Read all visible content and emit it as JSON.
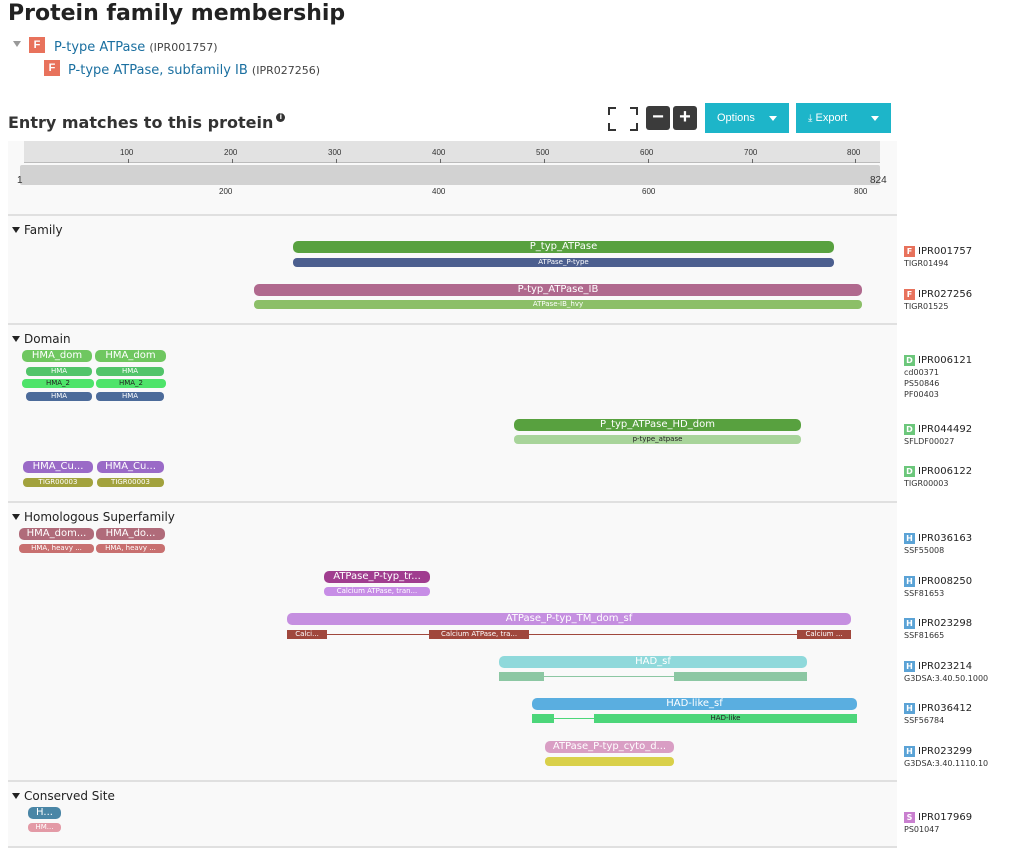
{
  "title": "Protein family membership",
  "family_tree": [
    {
      "badge": "F",
      "name": "P-type ATPase",
      "acc": "(IPR001757)"
    },
    {
      "badge": "F",
      "name": "P-type ATPase, subfamily IB",
      "acc": "(IPR027256)"
    }
  ],
  "entry_title": "Entry matches to this protein",
  "toolbar": {
    "options_label": "Options",
    "export_label": "Export",
    "minus": "−",
    "plus": "+"
  },
  "ruler": {
    "top_ticks": [
      "100",
      "200",
      "300",
      "400",
      "500",
      "600",
      "700",
      "800"
    ],
    "bottom_ticks": [
      "200",
      "400",
      "600",
      "800"
    ],
    "start": "1",
    "end": "824"
  },
  "sections": {
    "family": "Family",
    "domain": "Domain",
    "homologous": "Homologous Superfamily",
    "conserved": "Conserved Site"
  },
  "bars": {
    "f1": "P_typ_ATPase",
    "f1s": "ATPase_P-type",
    "f2": "P-typ_ATPase_IB",
    "f2s": "ATPase-IB_hvy",
    "d1a": "HMA_dom",
    "d1b": "HMA_dom",
    "d1c": "HMA",
    "d1d": "HMA",
    "d1e": "HMA_2",
    "d1f": "HMA_2",
    "d1g": "HMA",
    "d1h": "HMA",
    "d2": "P_typ_ATPase_HD_dom",
    "d2s": "p-type_atpase",
    "d3a": "HMA_Cu...",
    "d3b": "HMA_Cu...",
    "d3c": "TIGR00003",
    "d3d": "TIGR00003",
    "h1a": "HMA_dom...",
    "h1b": "HMA_do...",
    "h1c": "HMA, heavy ...",
    "h1d": "HMA, heavy ...",
    "h2": "ATPase_P-typ_tr...",
    "h2s": "Calcium ATPase, tran...",
    "h3": "ATPase_P-typ_TM_dom_sf",
    "h3a": "Calci...",
    "h3b": "Calcium ATPase, tra...",
    "h3c": "Calcium ...",
    "h4": "HAD_sf",
    "h5": "HAD-like_sf",
    "h5s": "HAD-like",
    "h6": "ATPase_P-typ_cyto_d...",
    "c1": "H...",
    "c1s": "HM..."
  },
  "entries": [
    {
      "badge": "F",
      "acc": "IPR001757",
      "sigs": [
        "TIGR01494"
      ]
    },
    {
      "badge": "F",
      "acc": "IPR027256",
      "sigs": [
        "TIGR01525"
      ]
    },
    {
      "badge": "D",
      "acc": "IPR006121",
      "sigs": [
        "cd00371",
        "PS50846",
        "PF00403"
      ]
    },
    {
      "badge": "D",
      "acc": "IPR044492",
      "sigs": [
        "SFLDF00027"
      ]
    },
    {
      "badge": "D",
      "acc": "IPR006122",
      "sigs": [
        "TIGR00003"
      ]
    },
    {
      "badge": "H",
      "acc": "IPR036163",
      "sigs": [
        "SSF55008"
      ]
    },
    {
      "badge": "H",
      "acc": "IPR008250",
      "sigs": [
        "SSF81653"
      ]
    },
    {
      "badge": "H",
      "acc": "IPR023298",
      "sigs": [
        "SSF81665"
      ]
    },
    {
      "badge": "H",
      "acc": "IPR023214",
      "sigs": [
        "G3DSA:3.40.50.1000"
      ]
    },
    {
      "badge": "H",
      "acc": "IPR036412",
      "sigs": [
        "SSF56784"
      ]
    },
    {
      "badge": "H",
      "acc": "IPR023299",
      "sigs": [
        "G3DSA:3.40.1110.10"
      ]
    },
    {
      "badge": "S",
      "acc": "IPR017969",
      "sigs": [
        "PS01047"
      ]
    }
  ],
  "colors": {
    "F": "#e8725c",
    "D": "#6cc77b",
    "H": "#5ba3d6",
    "S": "#c97fcf",
    "accent": "#1db5c9"
  }
}
